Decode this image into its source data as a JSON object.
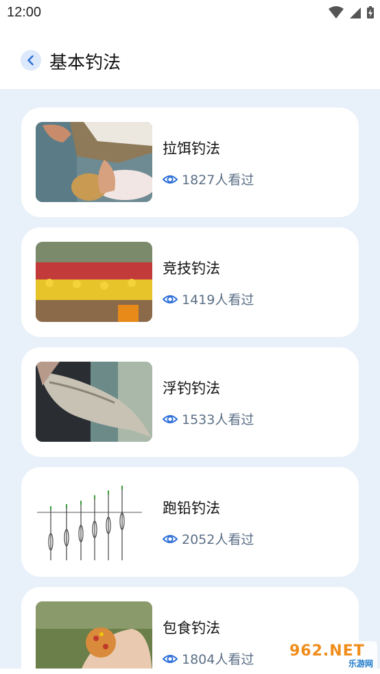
{
  "status_bar": {
    "time": "12:00"
  },
  "header": {
    "title": "基本钓法"
  },
  "list": [
    {
      "title": "拉饵钓法",
      "views": "1827人看过",
      "thumb_icon": "bait-hands-photo"
    },
    {
      "title": "竞技钓法",
      "views": "1419人看过",
      "thumb_icon": "fishing-competition-photo"
    },
    {
      "title": "浮钓钓法",
      "views": "1533人看过",
      "thumb_icon": "caught-fish-photo"
    },
    {
      "title": "跑铅钓法",
      "views": "2052人看过",
      "thumb_icon": "float-rig-diagram"
    },
    {
      "title": "包食钓法",
      "views": "1804人看过",
      "thumb_icon": "bait-ball-photo"
    }
  ],
  "watermark": {
    "main": "962.NET",
    "sub": "乐游网"
  },
  "colors": {
    "accent": "#2e6fd8",
    "background": "#e8f0f9",
    "card": "#ffffff"
  }
}
